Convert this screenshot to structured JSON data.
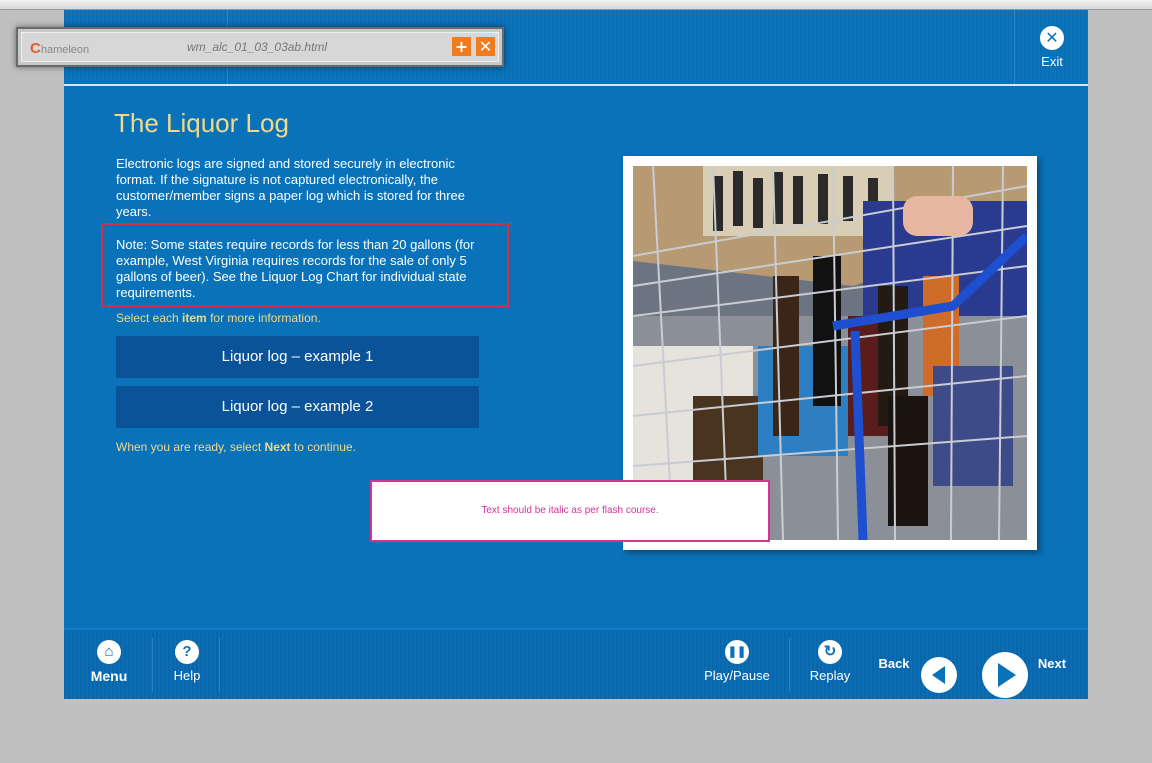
{
  "app": {
    "title": "The Liquor Log",
    "exit_label": "Exit",
    "body_text": "Electronic logs are signed and stored securely in electronic format.  If the signature is not captured electronically, the customer/member signs a paper log which is stored for three years.",
    "note_text": "Note: Some states require records for less than 20 gallons (for example, West Virginia requires records for the sale of only 5 gallons of beer).  See the Liquor Log Chart for individual state requirements.",
    "instruction": {
      "pre": "Select each ",
      "bold": "item",
      "post": " for more information."
    },
    "buttons": [
      {
        "label": "Liquor log – example 1"
      },
      {
        "label": "Liquor log – example 2"
      }
    ],
    "continue": {
      "pre": "When you are ready, select ",
      "bold": "Next",
      "post": " to continue."
    }
  },
  "footer": {
    "menu": "Menu",
    "help": "Help",
    "play_pause": "Play/Pause",
    "replay": "Replay",
    "back": "Back",
    "next": "Next"
  },
  "popup": {
    "logo_initial": "C",
    "logo_rest": "hameleon",
    "filename": "wm_alc_01_03_03ab.html"
  },
  "comment": "Text should be italic as per flash course.",
  "colors": {
    "background_blue": "#0a72b9",
    "title_gold": "#f0d989",
    "button_blue": "#0a5398",
    "note_border": "#d42f42",
    "comment_pink": "#d63394"
  }
}
